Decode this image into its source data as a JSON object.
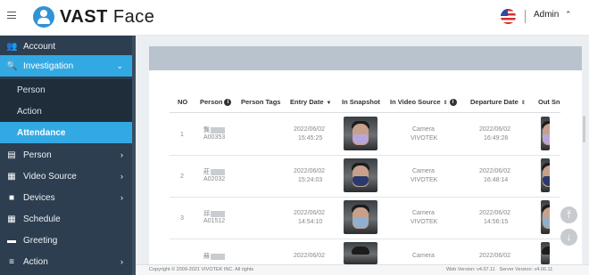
{
  "header": {
    "brand_bold": "VAST",
    "brand_light": " Face",
    "user": "Admin",
    "hamburger_icon": "menu-icon",
    "user_caret_icon": "chevron-up-icon",
    "flag_icon": "us-flag-icon"
  },
  "sidebar": {
    "items": [
      {
        "label": "Account",
        "icon": "users-icon",
        "glyph": "👥"
      },
      {
        "label": "Investigation",
        "icon": "search-icon",
        "glyph": "🔍",
        "active": true
      },
      {
        "label": "Person",
        "sub": true
      },
      {
        "label": "Action",
        "sub": true
      },
      {
        "label": "Attendance",
        "sub": true,
        "selected": true
      },
      {
        "label": "Person",
        "icon": "id-card-icon",
        "glyph": "▤",
        "arrow": true
      },
      {
        "label": "Video Source",
        "icon": "camera-icon",
        "glyph": "▦",
        "arrow": true
      },
      {
        "label": "Devices",
        "icon": "video-icon",
        "glyph": "■",
        "arrow": true
      },
      {
        "label": "Schedule",
        "icon": "calendar-icon",
        "glyph": "▦"
      },
      {
        "label": "Greeting",
        "icon": "comment-icon",
        "glyph": "▬"
      },
      {
        "label": "Action",
        "icon": "list-icon",
        "glyph": "≡",
        "arrow": true
      }
    ]
  },
  "table": {
    "headers": {
      "no": "NO",
      "person": "Person",
      "person_tags": "Person Tags",
      "entry_date": "Entry Date",
      "in_snapshot": "In Snapshot",
      "in_video_source": "In Video Source",
      "departure_date": "Departure Date",
      "out_snapshot": "Out Sn"
    },
    "rows": [
      {
        "no": "1",
        "name_char": "龔",
        "id": "A00353",
        "entry_date": "2022/06/02",
        "entry_time": "15:45:25",
        "camera": "Camera",
        "vendor": "VIVOTEK",
        "departure_date": "2022/06/02",
        "departure_time": "16:49:28",
        "mask_color": "#b9a6d8"
      },
      {
        "no": "2",
        "name_char": "莊",
        "id": "A02032",
        "entry_date": "2022/06/02",
        "entry_time": "15:24:03",
        "camera": "Camera",
        "vendor": "VIVOTEK",
        "departure_date": "2022/06/02",
        "departure_time": "16:48:14",
        "mask_color": "#2b3a6e"
      },
      {
        "no": "3",
        "name_char": "邱",
        "id": "A01512",
        "entry_date": "2022/06/02",
        "entry_time": "14:54:10",
        "camera": "Camera",
        "vendor": "VIVOTEK",
        "departure_date": "2022/06/02",
        "departure_time": "14:56:15",
        "mask_color": "#8fb0cf"
      }
    ],
    "partial_row": {
      "name_char": "蘇",
      "entry_date": "2022/06/02",
      "camera": "Camera",
      "departure_date": "2022/06/02"
    }
  },
  "footer": {
    "copyright": "Copyright © 2009-2021 VIVOTEK INC. All rights",
    "web_version": "Web Version: v4.07.11",
    "server_version": "Server Version: v4.06.11"
  },
  "fabs": {
    "top": "⤒",
    "down": "↓"
  },
  "colors": {
    "sidebar": "#2d3e50",
    "active": "#33a9e3",
    "sub": "#1f2d3b"
  }
}
